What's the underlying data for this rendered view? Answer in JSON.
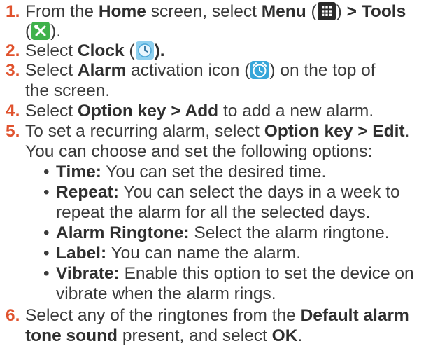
{
  "steps": [
    {
      "number": "1.",
      "line1": {
        "t1": "From the ",
        "b1": "Home",
        "t2": " screen, select ",
        "b2": "Menu",
        "t3": " (",
        "t4": ") ",
        "b3": "> Tools"
      },
      "line2": {
        "t1": "(",
        "t2": ")."
      }
    },
    {
      "number": "2.",
      "t1": "Select ",
      "b1": "Clock",
      "t2": " (",
      "t3": ")."
    },
    {
      "number": "3.",
      "line1": {
        "t1": "Select ",
        "b1": "Alarm",
        "t2": " activation icon (",
        "t3": ") on the top of"
      },
      "line2": "the screen."
    },
    {
      "number": "4.",
      "t1": "Select ",
      "b1": "Option key > Add",
      "t2": " to add a new alarm."
    },
    {
      "number": "5.",
      "line1": {
        "t1": "To set a recurring alarm, select ",
        "b1": "Option key > Edit",
        "t2": "."
      },
      "line2": "You can choose and set the following options:"
    },
    {
      "number": "6.",
      "line1": {
        "t1": "Select any of the ringtones from the ",
        "b1": "Default alarm"
      },
      "line2": {
        "b1": "tone sound",
        "t1": " present, and select ",
        "b2": "OK",
        "t2": "."
      }
    }
  ],
  "options": [
    {
      "label": "Time:",
      "text": " You can set the desired time."
    },
    {
      "label": "Repeat:",
      "text": " You can select the days in a week to",
      "text2": "repeat the alarm for all the selected days."
    },
    {
      "label": "Alarm Ringtone:",
      "text": " Select the alarm ringtone."
    },
    {
      "label": "Label:",
      "text": " You can name the alarm."
    },
    {
      "label": "Vibrate:",
      "text": " Enable this option to set the device on",
      "text2": "vibrate when the alarm rings."
    }
  ],
  "bullet_char": "•",
  "icons": {
    "menu": "menu-grid-icon",
    "tools": "tools-icon",
    "clock": "clock-app-icon",
    "alarm": "alarm-activation-icon"
  },
  "colors": {
    "step_number": "#e0522d",
    "text": "#3a3a3a"
  }
}
